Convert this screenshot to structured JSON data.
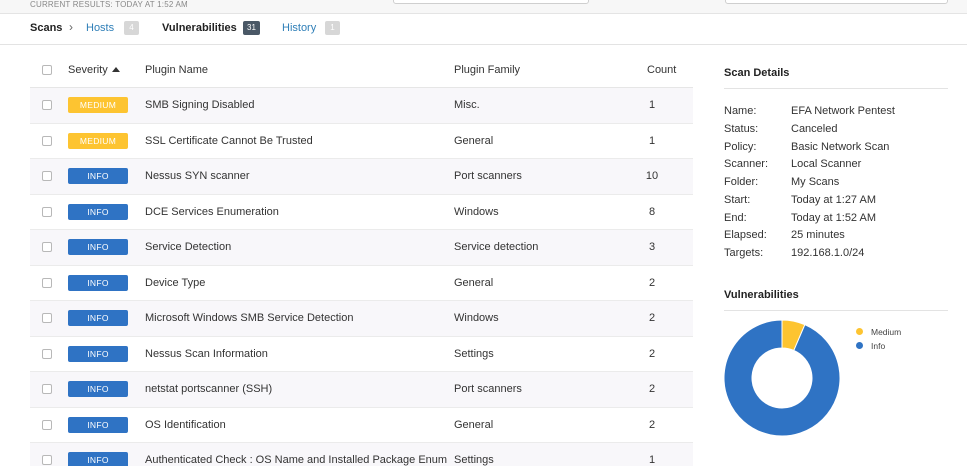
{
  "header": {
    "current_results": "CURRENT RESULTS: TODAY AT 1:52 AM"
  },
  "tabs": {
    "scans": "Scans",
    "chevron": "›",
    "hosts": "Hosts",
    "hosts_count": "4",
    "vulnerabilities": "Vulnerabilities",
    "vulnerabilities_count": "31",
    "history": "History",
    "history_count": "1"
  },
  "table": {
    "columns": {
      "severity": "Severity",
      "plugin_name": "Plugin Name",
      "plugin_family": "Plugin Family",
      "count": "Count"
    },
    "rows": [
      {
        "severity": "MEDIUM",
        "name": "SMB Signing Disabled",
        "family": "Misc.",
        "count": "1"
      },
      {
        "severity": "MEDIUM",
        "name": "SSL Certificate Cannot Be Trusted",
        "family": "General",
        "count": "1"
      },
      {
        "severity": "INFO",
        "name": "Nessus SYN scanner",
        "family": "Port scanners",
        "count": "10"
      },
      {
        "severity": "INFO",
        "name": "DCE Services Enumeration",
        "family": "Windows",
        "count": "8"
      },
      {
        "severity": "INFO",
        "name": "Service Detection",
        "family": "Service detection",
        "count": "3"
      },
      {
        "severity": "INFO",
        "name": "Device Type",
        "family": "General",
        "count": "2"
      },
      {
        "severity": "INFO",
        "name": "Microsoft Windows SMB Service Detection",
        "family": "Windows",
        "count": "2"
      },
      {
        "severity": "INFO",
        "name": "Nessus Scan Information",
        "family": "Settings",
        "count": "2"
      },
      {
        "severity": "INFO",
        "name": "netstat portscanner (SSH)",
        "family": "Port scanners",
        "count": "2"
      },
      {
        "severity": "INFO",
        "name": "OS Identification",
        "family": "General",
        "count": "2"
      },
      {
        "severity": "INFO",
        "name": "Authenticated Check : OS Name and Installed Package Enum",
        "family": "Settings",
        "count": "1"
      }
    ]
  },
  "scan_details": {
    "title": "Scan Details",
    "items": [
      {
        "label": "Name:",
        "value": "EFA Network Pentest"
      },
      {
        "label": "Status:",
        "value": "Canceled"
      },
      {
        "label": "Policy:",
        "value": "Basic Network Scan"
      },
      {
        "label": "Scanner:",
        "value": "Local Scanner"
      },
      {
        "label": "Folder:",
        "value": "My Scans"
      },
      {
        "label": "Start:",
        "value": "Today at 1:27 AM"
      },
      {
        "label": "End:",
        "value": "Today at 1:52 AM"
      },
      {
        "label": "Elapsed:",
        "value": "25 minutes"
      },
      {
        "label": "Targets:",
        "value": "192.168.1.0/24"
      }
    ]
  },
  "vulnerabilities_panel": {
    "title": "Vulnerabilities",
    "legend": [
      {
        "name": "Medium",
        "color": "#fdc431"
      },
      {
        "name": "Info",
        "color": "#2f73c4"
      }
    ]
  },
  "chart_data": {
    "type": "pie",
    "title": "Vulnerabilities",
    "categories": [
      "Medium",
      "Info"
    ],
    "values": [
      2,
      29
    ],
    "colors": [
      "#fdc431",
      "#2f73c4"
    ],
    "donut": true,
    "legend": "top-right"
  },
  "colors": {
    "medium": "#fdc431",
    "info": "#2f73c4",
    "link": "#2f7fb8"
  }
}
